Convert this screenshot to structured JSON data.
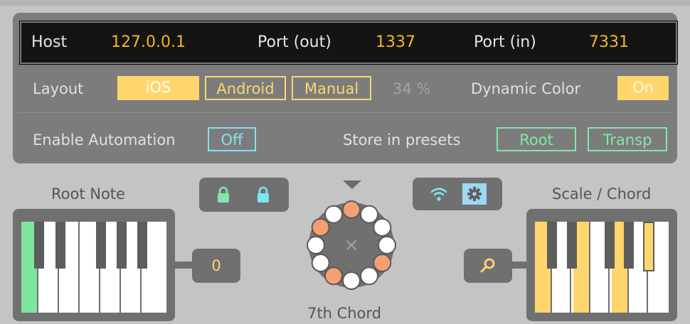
{
  "connection": {
    "host_label": "Host",
    "host_value": "127.0.0.1",
    "port_out_label": "Port (out)",
    "port_out_value": "1337",
    "port_in_label": "Port (in)",
    "port_in_value": "7331"
  },
  "layout": {
    "label": "Layout",
    "options": [
      "iOS",
      "Android",
      "Manual"
    ],
    "selected": "iOS",
    "manual_value": "34 %"
  },
  "dynamic_color": {
    "label": "Dynamic Color",
    "value": "On"
  },
  "automation": {
    "label": "Enable Automation",
    "value": "Off"
  },
  "presets": {
    "label": "Store in presets",
    "options": [
      "Root",
      "Transp"
    ]
  },
  "root_note": {
    "label": "Root Note",
    "value": "0"
  },
  "chord": {
    "label": "7th Chord",
    "center_icon": "close-icon",
    "active_positions": [
      0,
      4,
      7,
      10
    ]
  },
  "scale_chord": {
    "label": "Scale / Chord"
  },
  "icons": {
    "lock_green": "lock-icon",
    "lock_cyan": "lock-icon",
    "wifi": "wifi-icon",
    "settings": "gear-icon",
    "search": "search-icon"
  },
  "colors": {
    "accent_yellow": "#ffd66e",
    "value_orange": "#f2b627",
    "cyan": "#7ee5f2",
    "green": "#82e8a8",
    "chord_orange": "#f4a072"
  }
}
